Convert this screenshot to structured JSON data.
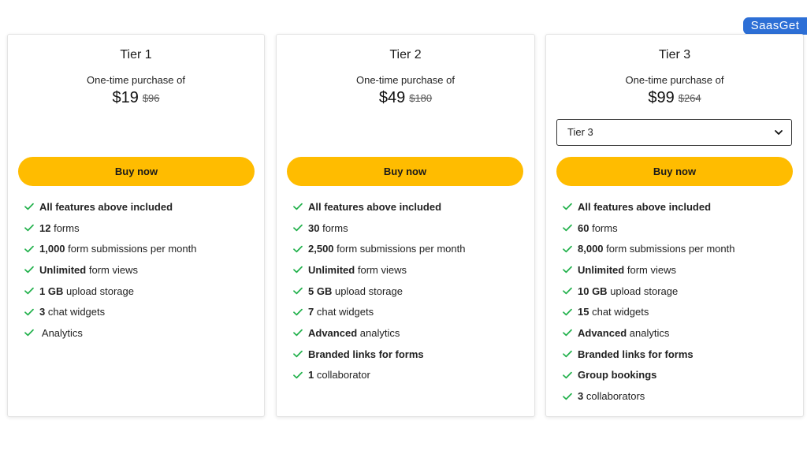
{
  "brand": "SaasGet",
  "colors": {
    "accent": "#ffbc00",
    "check": "#22b14c",
    "brand_bg": "#2d6fd6"
  },
  "tiers": [
    {
      "title": "Tier 1",
      "purchase_label": "One-time purchase of",
      "price": "$19",
      "original_price": "$96",
      "buy_label": "Buy now",
      "features": [
        {
          "bold": "All features above included",
          "rest": ""
        },
        {
          "bold": "12",
          "rest": "forms"
        },
        {
          "bold": "1,000",
          "rest": "form submissions per month"
        },
        {
          "bold": "Unlimited",
          "rest": "form views"
        },
        {
          "bold": "1 GB",
          "rest": "upload storage"
        },
        {
          "bold": "3",
          "rest": "chat widgets"
        },
        {
          "bold": "",
          "rest": "Analytics"
        }
      ]
    },
    {
      "title": "Tier 2",
      "purchase_label": "One-time purchase of",
      "price": "$49",
      "original_price": "$180",
      "buy_label": "Buy now",
      "features": [
        {
          "bold": "All features above included",
          "rest": ""
        },
        {
          "bold": "30",
          "rest": "forms"
        },
        {
          "bold": "2,500",
          "rest": "form submissions per month"
        },
        {
          "bold": "Unlimited",
          "rest": "form views"
        },
        {
          "bold": "5 GB",
          "rest": "upload storage"
        },
        {
          "bold": "7",
          "rest": "chat widgets"
        },
        {
          "bold": "Advanced",
          "rest": "analytics"
        },
        {
          "bold": "Branded links for forms",
          "rest": ""
        },
        {
          "bold": "1",
          "rest": "collaborator"
        }
      ]
    },
    {
      "title": "Tier 3",
      "purchase_label": "One-time purchase of",
      "price": "$99",
      "original_price": "$264",
      "select_value": "Tier 3",
      "buy_label": "Buy now",
      "features": [
        {
          "bold": "All features above included",
          "rest": ""
        },
        {
          "bold": "60",
          "rest": "forms"
        },
        {
          "bold": "8,000",
          "rest": "form submissions per month"
        },
        {
          "bold": "Unlimited",
          "rest": "form views"
        },
        {
          "bold": "10 GB",
          "rest": "upload storage"
        },
        {
          "bold": "15",
          "rest": "chat widgets"
        },
        {
          "bold": "Advanced",
          "rest": "analytics"
        },
        {
          "bold": "Branded links for forms",
          "rest": ""
        },
        {
          "bold": "Group bookings",
          "rest": ""
        },
        {
          "bold": "3",
          "rest": "collaborators"
        }
      ]
    }
  ]
}
